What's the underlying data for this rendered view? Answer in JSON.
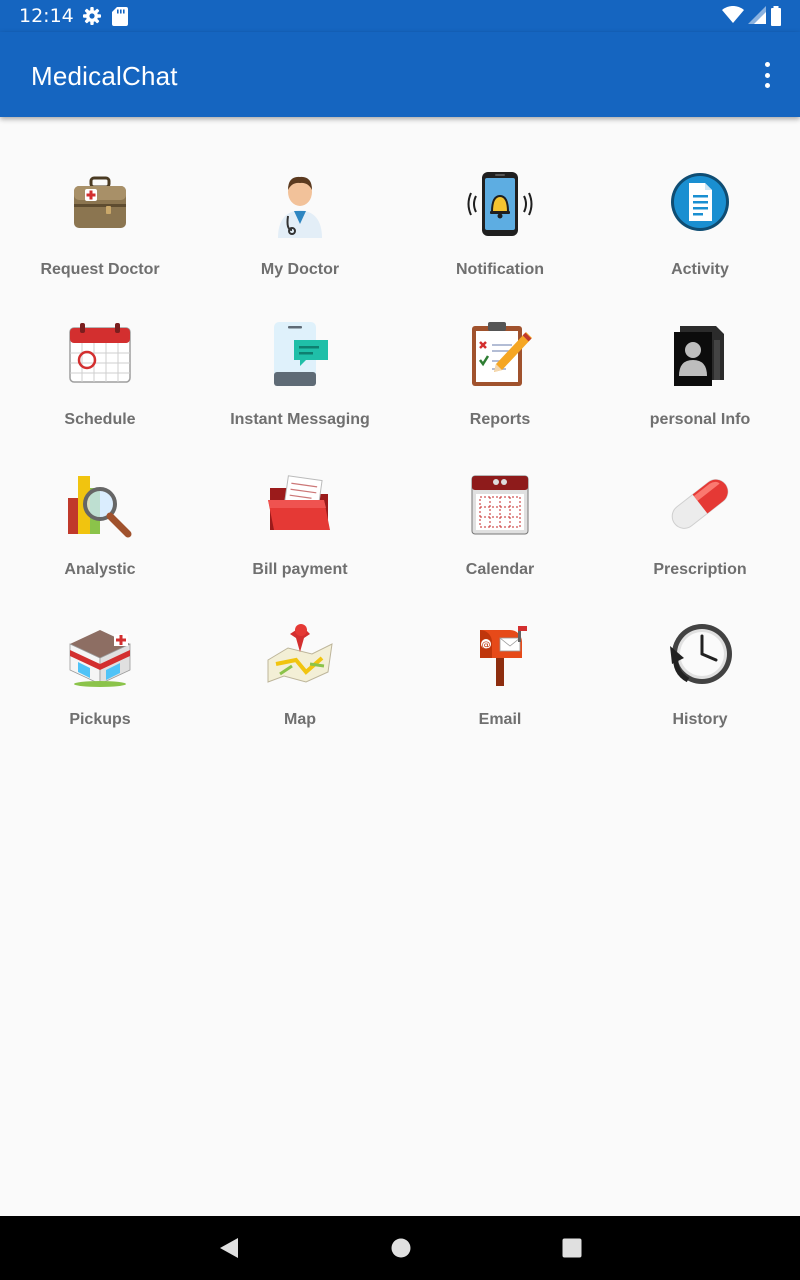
{
  "status_bar": {
    "time": "12:14",
    "icons": [
      "gear-icon",
      "sd-card-icon",
      "wifi-icon",
      "signal-icon",
      "battery-icon"
    ]
  },
  "app_bar": {
    "title": "MedicalChat",
    "menu_icon": "overflow-menu-icon"
  },
  "colors": {
    "primary": "#1565c0",
    "background": "#fafafa",
    "label": "#6f6f6f"
  },
  "grid": {
    "items": [
      {
        "label": "Request Doctor",
        "icon": "medical-bag-icon"
      },
      {
        "label": "My Doctor",
        "icon": "doctor-icon"
      },
      {
        "label": "Notification",
        "icon": "phone-bell-icon"
      },
      {
        "label": "Activity",
        "icon": "document-circle-icon"
      },
      {
        "label": "Schedule",
        "icon": "calendar-schedule-icon"
      },
      {
        "label": "Instant Messaging",
        "icon": "phone-chat-icon"
      },
      {
        "label": "Reports",
        "icon": "clipboard-pencil-icon"
      },
      {
        "label": "personal Info",
        "icon": "contact-folder-icon"
      },
      {
        "label": "Analystic",
        "icon": "chart-magnifier-icon"
      },
      {
        "label": "Bill payment",
        "icon": "red-folder-icon"
      },
      {
        "label": "Calendar",
        "icon": "calendar-icon"
      },
      {
        "label": "Prescription",
        "icon": "pill-icon"
      },
      {
        "label": "Pickups",
        "icon": "pharmacy-store-icon"
      },
      {
        "label": "Map",
        "icon": "map-pin-icon"
      },
      {
        "label": "Email",
        "icon": "mailbox-icon"
      },
      {
        "label": "History",
        "icon": "clock-history-icon"
      }
    ]
  },
  "nav_bar": {
    "buttons": [
      "back-icon",
      "home-icon",
      "recent-apps-icon"
    ]
  }
}
